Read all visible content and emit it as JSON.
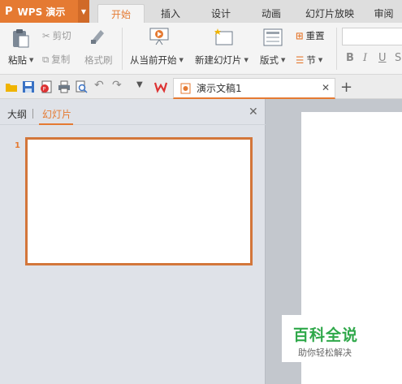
{
  "app": {
    "logo": "P",
    "name": "WPS 演示",
    "accent": "#e57a32"
  },
  "ribbon_tabs": [
    "开始",
    "插入",
    "设计",
    "动画",
    "幻灯片放映",
    "审阅"
  ],
  "ribbon": {
    "paste": "粘贴",
    "cut": "剪切",
    "copy": "复制",
    "format_painter": "格式刷",
    "start_from_current": "从当前开始",
    "new_slide": "新建幻灯片",
    "layout": "版式",
    "reset": "重置",
    "section": "节",
    "bold": "B",
    "italic": "I",
    "underline": "U",
    "strike": "S"
  },
  "document_tab": {
    "title": "演示文稿1"
  },
  "left_panel": {
    "tab_outline": "大纲",
    "tab_slides": "幻灯片",
    "slide_number": "1"
  },
  "watermark": {
    "title": "百科全说",
    "subtitle": "助你轻松解决"
  }
}
